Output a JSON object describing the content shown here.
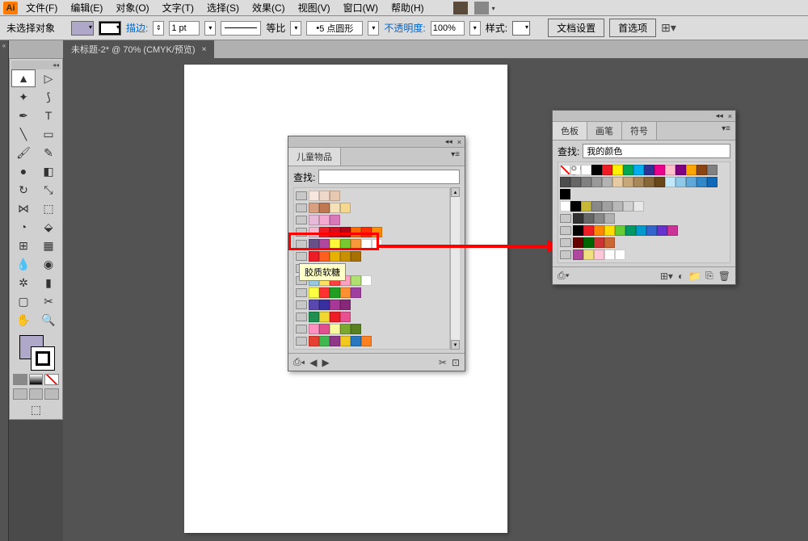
{
  "app_logo": "Ai",
  "menu": [
    "文件(F)",
    "编辑(E)",
    "对象(O)",
    "文字(T)",
    "选择(S)",
    "效果(C)",
    "视图(V)",
    "窗口(W)",
    "帮助(H)"
  ],
  "optbar": {
    "no_selection": "未选择对象",
    "stroke_label": "描边:",
    "stroke_width": "1 pt",
    "uniform": "等比",
    "dash": "5 点圆形",
    "opacity_label": "不透明度:",
    "opacity": "100%",
    "style_label": "样式:",
    "doc_setup": "文档设置",
    "prefs": "首选项"
  },
  "doc_tab": "未标题-2* @ 70% (CMYK/预览)",
  "panel_left": {
    "title": "儿童物品",
    "search_label": "查找:",
    "search_value": "",
    "tooltip": "胶质软糖",
    "rows": [
      [
        "#f5e6e0",
        "#f0d8c8",
        "#e8c8b0"
      ],
      [
        "#d8a080",
        "#c07850",
        "#f5e0b8",
        "#f5d890"
      ],
      [
        "#e8b8d8",
        "#f5a8d0",
        "#d878b8"
      ],
      [
        "#f5b8d0",
        "#ee1c25",
        "#d01020",
        "#b00818",
        "#ff6800",
        "#ff3000",
        "#ff8c00"
      ],
      [
        "#685088",
        "#b048a0",
        "#fff838",
        "#78c830",
        "#f89838",
        "#ffffff",
        "#ffffff"
      ],
      [
        "#ee1c25",
        "#ff6020",
        "#e8b000",
        "#c89000",
        "#a87000"
      ],
      [
        "#ee1c25",
        "#000000"
      ],
      [
        "#98c8e0",
        "#ffe060",
        "#ff4040",
        "#ffa0c0",
        "#b0e070",
        "#ffffff"
      ],
      [
        "#ffff40",
        "#ff3030",
        "#20a020",
        "#ff9030",
        "#a040a0"
      ],
      [
        "#5848b0",
        "#3830a0",
        "#a83898",
        "#882878"
      ],
      [
        "#209050",
        "#f0d830",
        "#ee1c25",
        "#e85090"
      ],
      [
        "#ff90c0",
        "#e05090",
        "#f8f8a0",
        "#78a830",
        "#588020"
      ],
      [
        "#e84030",
        "#40b850",
        "#903888",
        "#f0c820",
        "#2878c0",
        "#ff8020"
      ]
    ]
  },
  "panel_right": {
    "tabs": [
      "色板",
      "画笔",
      "符号"
    ],
    "search_label": "查找:",
    "search_value": "我的颜色",
    "row1": [
      "none",
      "reg",
      "#ffffff",
      "#000000",
      "#ee1c25",
      "#fff200",
      "#00a651",
      "#00aeef",
      "#2e3192",
      "#ec008c",
      "#ffc0cb",
      "#800080",
      "#ffa500",
      "#8b4513",
      "#808080"
    ],
    "row2": [
      "#4d4d4d",
      "#666666",
      "#808080",
      "#999999",
      "#b3b3b3",
      "#e6cba3",
      "#c8a878",
      "#a88858",
      "#886838",
      "#684818",
      "#c0e8f8",
      "#90c8e8",
      "#60a8d8",
      "#3088c8",
      "#1068b8"
    ],
    "row_black": [
      "#000000"
    ],
    "row_circles": [
      "#ffffff",
      "#000000",
      "#c8b838",
      "#888888",
      "#a0a0a0",
      "#b8b8b8",
      "#d0d0d0",
      "#e8e8e8"
    ],
    "row_folder1": [
      "#333333",
      "#666666",
      "#888888",
      "#b0b0b0"
    ],
    "row_folder2": [
      "#000000",
      "#ee1c25",
      "#ff8800",
      "#ffdd00",
      "#66cc33",
      "#009966",
      "#0099cc",
      "#3366cc",
      "#6633cc",
      "#cc3399"
    ],
    "row_folder3": [
      "#660000",
      "#006600",
      "#cc3333",
      "#cc6633"
    ],
    "row_folder4": [
      "#b048a0",
      "#f0e080",
      "#ffc8d8",
      "#ffffff",
      "#ffffff"
    ]
  }
}
